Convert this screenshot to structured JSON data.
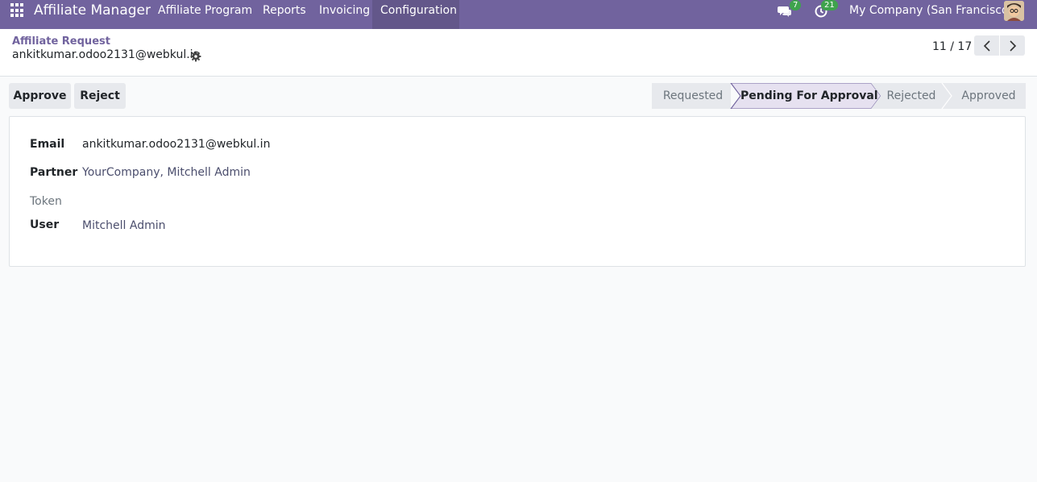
{
  "navbar": {
    "brand": "Affiliate Manager",
    "menu": [
      "Affiliate Program",
      "Reports",
      "Invoicing",
      "Configuration"
    ],
    "active_menu": "Configuration",
    "messages_count": "7",
    "activities_count": "21",
    "company": "My Company (San Francisco)",
    "accent_color": "#71639e"
  },
  "breadcrumb": {
    "parent": "Affiliate Request",
    "current": "ankitkumar.odoo2131@webkul.in"
  },
  "pager": {
    "value": "11 / 17"
  },
  "actions": {
    "approve_label": "Approve",
    "reject_label": "Reject"
  },
  "status": {
    "stages": [
      "Requested",
      "Pending For Approval",
      "Rejected",
      "Approved"
    ],
    "current": "Pending For Approval"
  },
  "form": {
    "email_label": "Email",
    "email_value": "ankitkumar.odoo2131@webkul.in",
    "partner_label": "Partner",
    "partner_value": "YourCompany, Mitchell Admin",
    "token_label": "Token",
    "token_value": "",
    "user_label": "User",
    "user_value": "Mitchell Admin"
  }
}
